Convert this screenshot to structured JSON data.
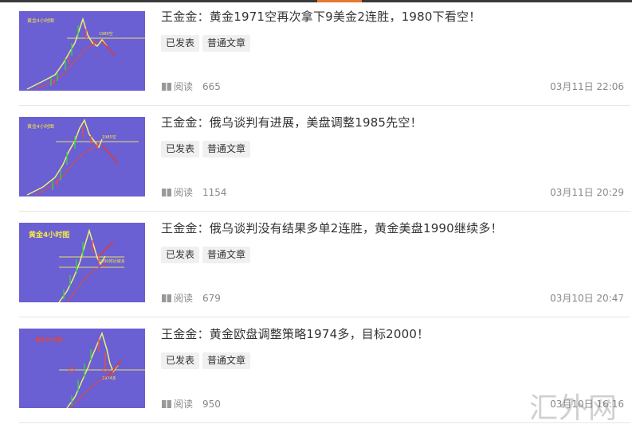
{
  "articles": [
    {
      "title": "王金金：黄金1971空再次拿下9美金2连胜，1980下看空！",
      "tags": [
        "已发表",
        "普通文章"
      ],
      "views_label": "阅读",
      "views": "665",
      "date": "03月11日 22:06",
      "thumb": {
        "chart_title": "黄金4小时图",
        "annotation": "1980空"
      }
    },
    {
      "title": "王金金：俄乌谈判有进展，美盘调整1985先空！",
      "tags": [
        "已发表",
        "普通文章"
      ],
      "views_label": "阅读",
      "views": "1154",
      "date": "03月11日 20:29",
      "thumb": {
        "chart_title": "黄金4小时图",
        "annotation": "1985空"
      }
    },
    {
      "title": "王金金：俄乌谈判没有结果多单2连胜，黄金美盘1990继续多！",
      "tags": [
        "已发表",
        "普通文章"
      ],
      "views_label": "阅读",
      "views": "679",
      "date": "03月10日 20:47",
      "thumb": {
        "chart_title": "黄金4小时图",
        "annotation": "1990附近做多"
      }
    },
    {
      "title": "王金金：黄金欧盘调整策略1974多，目标2000！",
      "tags": [
        "已发表",
        "普通文章"
      ],
      "views_label": "阅读",
      "views": "950",
      "date": "03月10日 16:16",
      "thumb": {
        "chart_title": "黄金4小时图",
        "annotation": "1974多"
      }
    }
  ],
  "watermark": "汇外网",
  "colors": {
    "thumb_bg": "#6a5fd3",
    "top_accent": "#e8772e",
    "meta_text": "#888888"
  }
}
